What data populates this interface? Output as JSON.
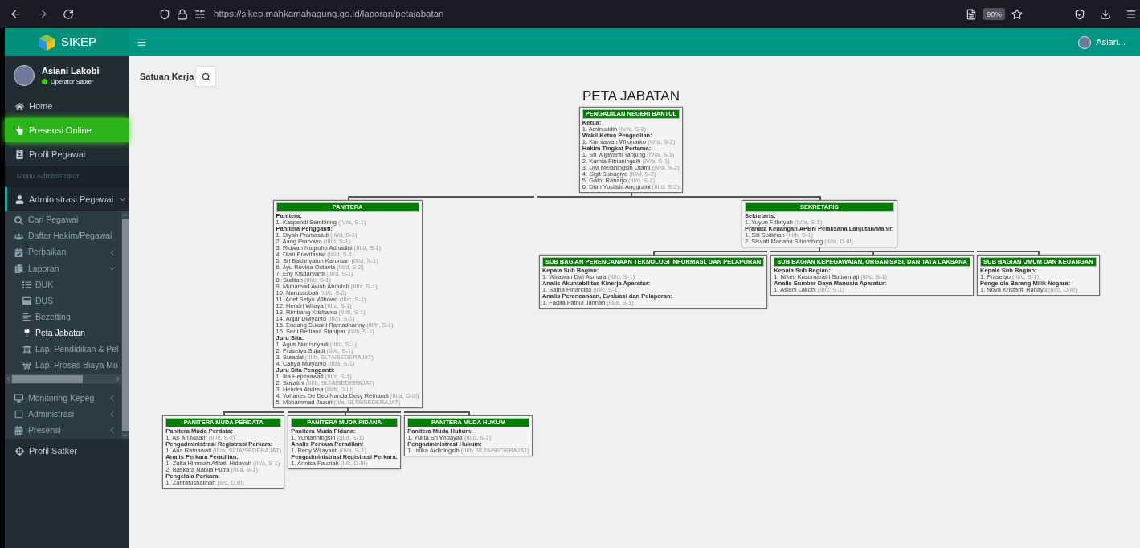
{
  "browser": {
    "url": "https://sikep.mahkamahagung.go.id/laporan/petajabatan",
    "zoom": "90%"
  },
  "header": {
    "brand": "SIKEP",
    "user": "Asian..."
  },
  "sidebar": {
    "user": {
      "name": "Asiani Lakobi",
      "role": "Operator Satker"
    },
    "items": [
      {
        "label": "Home",
        "kind": "link",
        "selected": false
      },
      {
        "label": "Presensi Online",
        "kind": "highlight"
      },
      {
        "label": "Profil Pegawai",
        "kind": "link",
        "selected": false
      },
      {
        "label": "Menu Administrator",
        "kind": "header"
      },
      {
        "label": "Administrasi Pegawai",
        "kind": "link",
        "selected": false,
        "expanded": true,
        "children": [
          {
            "label": "Cari Pegawai",
            "selected": false
          },
          {
            "label": "Daftar Hakim/Pegawai",
            "selected": false
          },
          {
            "label": "Perbaikan",
            "selected": false,
            "expanded": false
          },
          {
            "label": "Laporan",
            "selected": false,
            "expanded": true,
            "children": [
              {
                "label": "DUK",
                "selected": false
              },
              {
                "label": "DUS",
                "selected": false
              },
              {
                "label": "Bezetting",
                "selected": false
              },
              {
                "label": "Peta Jabatan",
                "selected": true
              },
              {
                "label": "Lap. Pendidikan & Pel",
                "selected": false
              },
              {
                "label": "Lap. Proses Biaya Mu",
                "selected": false
              }
            ]
          },
          {
            "label": "Monitoring Kepeg",
            "selected": false,
            "expanded": false
          },
          {
            "label": "Administrasi",
            "selected": false,
            "expanded": false
          },
          {
            "label": "Presensi",
            "selected": false,
            "expanded": false
          }
        ]
      },
      {
        "label": "Profil Satker",
        "kind": "link",
        "selected": false
      }
    ]
  },
  "filter": {
    "label": "Satuan Kerja"
  },
  "org_chart": {
    "title": "PETA JABATAN",
    "root": {
      "title": "PENGADILAN NEGERI BANTUL",
      "sections": [
        {
          "heading": "Ketua:",
          "people": [
            {
              "name": "1. Aminuddin",
              "grade": "(IV/c, S-2)"
            }
          ]
        },
        {
          "heading": "Wakil Ketua Pengadilan:",
          "people": [
            {
              "name": "1. Kurniawan Wijonarko",
              "grade": "(IV/a, S-2)"
            }
          ]
        },
        {
          "heading": "Hakim Tingkat Pertama:",
          "people": [
            {
              "name": "1. Sri Wijayanti Tanjung",
              "grade": "(IV/a, S-1)"
            },
            {
              "name": "2. Kurnia Fitrianingsih",
              "grade": "(IV/a, S-1)"
            },
            {
              "name": "3. Dwi Melaningsih Utami",
              "grade": "(IV/a, S-2)"
            },
            {
              "name": "4. Sigit Subagiyo",
              "grade": "(III/d, S-2)"
            },
            {
              "name": "5. Gatot Raharjo",
              "grade": "(III/d, S-2)"
            },
            {
              "name": "6. Dian Yustisia Anggraini",
              "grade": "(III/d, S-2)"
            }
          ]
        }
      ],
      "children": [
        {
          "title": "PANITERA",
          "sections": [
            {
              "heading": "Panitera:",
              "people": [
                {
                  "name": "1. Kaspendi Sembiring",
                  "grade": "(IV/a, S-1)"
                }
              ]
            },
            {
              "heading": "Panitera Pengganti:",
              "people": [
                {
                  "name": "1. Diyah Pramastuti",
                  "grade": "(III/d, S-1)"
                },
                {
                  "name": "2. Aang Prabowo",
                  "grade": "(III/d, S-1)"
                },
                {
                  "name": "3. Ridwan Nugroho Adhadini",
                  "grade": "(III/d, S-1)"
                },
                {
                  "name": "4. Diah Pravitasiwi",
                  "grade": "(III/d, S-1)"
                },
                {
                  "name": "5. Sri Bakhriyatun Karoman",
                  "grade": "(III/d, S-1)"
                },
                {
                  "name": "6. Ayu Revina Octavia",
                  "grade": "(III/d, S-2)"
                },
                {
                  "name": "7. Eny Kisdaryanti",
                  "grade": "(III/d, S-1)"
                },
                {
                  "name": "8. Sudilah",
                  "grade": "(III/c, S-1)"
                },
                {
                  "name": "9. Muhamad Awab Abdulah",
                  "grade": "(III/c, S-1)"
                },
                {
                  "name": "10. Nurussobah",
                  "grade": "(III/c, S-2)"
                },
                {
                  "name": "11. Arief Setyo Wibowo",
                  "grade": "(III/c, S-1)"
                },
                {
                  "name": "12. Hendri Wijaya",
                  "grade": "(III/c, S-1)"
                },
                {
                  "name": "13. Rimbang Kristianto",
                  "grade": "(III/b, S-1)"
                },
                {
                  "name": "14. Anjar Dwiyanto",
                  "grade": "(III/b, S-1)"
                },
                {
                  "name": "15. Endang Sukarti Ramadhanny",
                  "grade": "(III/b, S-1)"
                },
                {
                  "name": "16. Serli Berliana Sianipar",
                  "grade": "(III/b, S-1)"
                }
              ]
            },
            {
              "heading": "Juru Sita:",
              "people": [
                {
                  "name": "1. Agus Nur Isriyadi",
                  "grade": "(III/d, S-1)"
                },
                {
                  "name": "2. Prasetya Sujadi",
                  "grade": "(III/c, S-1)"
                },
                {
                  "name": "3. Suradal",
                  "grade": "(III/b, SLTA/SEDERAJAT)"
                },
                {
                  "name": "4. Cahya Mulyanto",
                  "grade": "(III/a, S-1)"
                }
              ]
            },
            {
              "heading": "Juru Sita Pengganti:",
              "people": [
                {
                  "name": "1. Ika Hepsyawati",
                  "grade": "(III/c, S-1)"
                },
                {
                  "name": "2. Suyatini",
                  "grade": "(III/b, SLTA/SEDERAJAT)"
                },
                {
                  "name": "3. Hendra Andrea",
                  "grade": "(III/b, D-III)"
                },
                {
                  "name": "4. Yohanes De Deo Nanda Desy Rethandi",
                  "grade": "(III/a, D-III)"
                },
                {
                  "name": "5. Mohammad Jazuri",
                  "grade": "(II/a, SLTA/SEDERAJAT)"
                }
              ]
            }
          ],
          "children": [
            {
              "title": "PANITERA MUDA PERDATA",
              "sections": [
                {
                  "heading": "Panitera Muda Perdata:",
                  "people": [
                    {
                      "name": "1. As`Ari Maarif",
                      "grade": "(III/c, S-2)"
                    }
                  ]
                },
                {
                  "heading": "Pengadministrasi Registrasi Perkara:",
                  "people": [
                    {
                      "name": "1. Ana Ratnawati",
                      "grade": "(III/a, SLTA/SEDERAJAT)"
                    }
                  ]
                },
                {
                  "heading": "Analis Perkara Peradilan:",
                  "people": [
                    {
                      "name": "1. Zulfa Himmah Afifatil Hidayah",
                      "grade": "(III/a, S-1)"
                    },
                    {
                      "name": "2. Baskara Nabila Putra",
                      "grade": "(III/a, S-1)"
                    }
                  ]
                },
                {
                  "heading": "Pengelola Perkara:",
                  "people": [
                    {
                      "name": "1. Zahratushalihah",
                      "grade": "(II/c, D-III)"
                    }
                  ]
                }
              ]
            },
            {
              "title": "PANITERA MUDA PIDANA",
              "sections": [
                {
                  "heading": "Panitera Muda Pidana:",
                  "people": [
                    {
                      "name": "1. Yuntariningsih",
                      "grade": "(III/d, S-1)"
                    }
                  ]
                },
                {
                  "heading": "Analis Perkara Peradilan:",
                  "people": [
                    {
                      "name": "1. Reny Wijayanti",
                      "grade": "(III/a, S-1)"
                    }
                  ]
                },
                {
                  "heading": "Pengadministrasi Registrasi Perkara:",
                  "people": [
                    {
                      "name": "1. Annisa Fauziah",
                      "grade": "(II/c, D-III)"
                    }
                  ]
                }
              ]
            },
            {
              "title": "PANITERA MUDA HUKUM",
              "sections": [
                {
                  "heading": "Panitera Muda Hukum:",
                  "people": [
                    {
                      "name": "1. Yulita Sri Widayati",
                      "grade": "(III/d, S-1)"
                    }
                  ]
                },
                {
                  "heading": "Pengadministrasi Hukum:",
                  "people": [
                    {
                      "name": "1. Istika Ardiningsih",
                      "grade": "(III/b, SLTA/SEDERAJAT)"
                    }
                  ]
                }
              ]
            }
          ]
        },
        {
          "title": "SEKRETARIS",
          "sections": [
            {
              "heading": "Sekretaris:",
              "people": [
                {
                  "name": "1. Yuyun Fithriyah",
                  "grade": "(IV/a, S-1)"
                }
              ]
            },
            {
              "heading": "Pranata Keuangan APBN Pelaksana Lanjutan/Mahir:",
              "people": [
                {
                  "name": "1. Siti Solikhah",
                  "grade": "(III/b, S-1)"
                },
                {
                  "name": "2. Sisvati Mariana Sihombing",
                  "grade": "(III/a, D-III)"
                }
              ]
            }
          ],
          "children": [
            {
              "title": "SUB BAGIAN PERENCANAAN TEKNOLOGI INFORMASI, DAN PELAPORAN",
              "sections": [
                {
                  "heading": "Kepala Sub Bagian:",
                  "people": [
                    {
                      "name": "1. Wirawan Dwi Asmara",
                      "grade": "(III/d, S-1)"
                    }
                  ]
                },
                {
                  "heading": "Analis Akuntabilitas Kinerja Aparatur:",
                  "people": [
                    {
                      "name": "1. Satria Pinandita",
                      "grade": "(III/c, S-1)"
                    }
                  ]
                },
                {
                  "heading": "Analis Perencanaan, Evaluasi dan Pelaporan:",
                  "people": [
                    {
                      "name": "1. Fadila Fathul Jannah",
                      "grade": "(III/a, S-1)"
                    }
                  ]
                }
              ]
            },
            {
              "title": "SUB BAGIAN KEPEGAWAIAN, ORGANISASI, DAN TATA LAKSANA",
              "sections": [
                {
                  "heading": "Kepala Sub Bagian:",
                  "people": [
                    {
                      "name": "1. Niken Kusumaratri Sudarmaji",
                      "grade": "(III/c, S-1)"
                    }
                  ]
                },
                {
                  "heading": "Analis Sumber Daya Manusia Aparatur:",
                  "people": [
                    {
                      "name": "1. Asiani Lakobi",
                      "grade": "(III/c, S-1)"
                    }
                  ]
                }
              ]
            },
            {
              "title": "SUB BAGIAN UMUM DAN KEUANGAN",
              "sections": [
                {
                  "heading": "Kepala Sub Bagian:",
                  "people": [
                    {
                      "name": "1. Prasetyo",
                      "grade": "(III/c, S-1)"
                    }
                  ]
                },
                {
                  "heading": "Pengelola Barang Milik Negara:",
                  "people": [
                    {
                      "name": "1. Nova Kristanti Rahayu",
                      "grade": "(III/c, D-III)"
                    }
                  ]
                }
              ]
            }
          ]
        }
      ]
    }
  }
}
